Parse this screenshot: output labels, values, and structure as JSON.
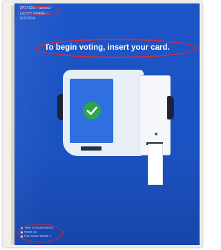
{
  "header": {
    "school": "20240507 School",
    "line2": "DEMO SPARE 1",
    "line3": "5/7/2024"
  },
  "main": {
    "prompt": "To begin voting, insert your card."
  },
  "footer": {
    "time": "Time: 10:30 AM 5/30/24",
    "power": "Power: AC",
    "pod": "Pod: DEMO SPARE 1"
  },
  "colors": {
    "screen": "#1d55c8",
    "annotation": "#d9283a",
    "check": "#2ea44f"
  },
  "icons": {
    "checkmark": "check-icon",
    "clock": "clock-icon",
    "power": "power-icon",
    "pod": "pod-icon"
  }
}
